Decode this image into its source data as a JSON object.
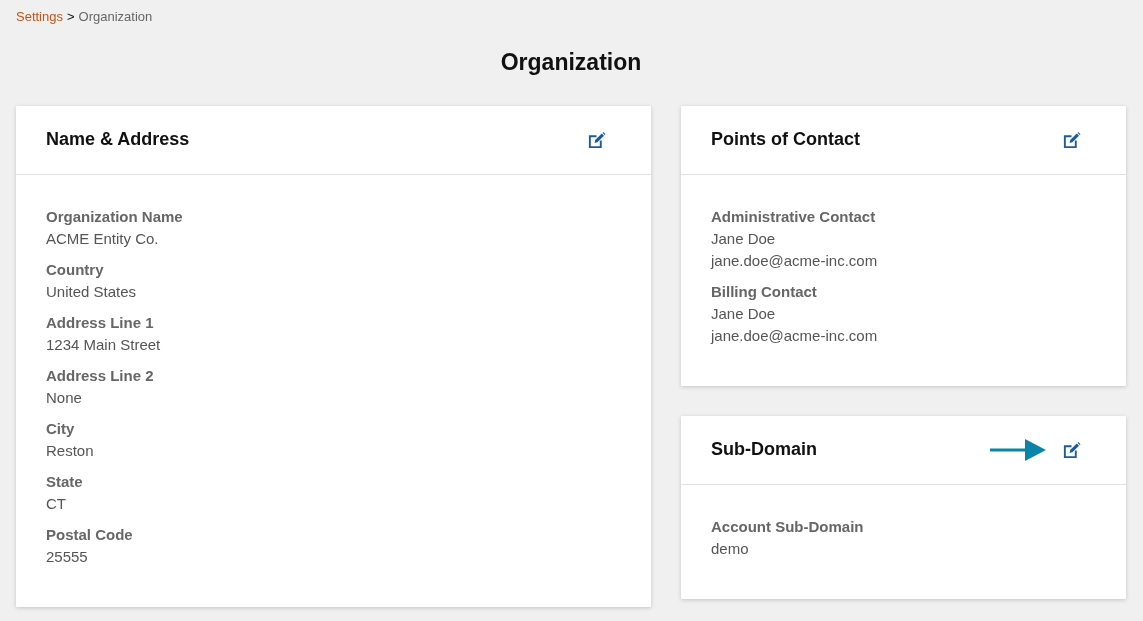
{
  "breadcrumb": [
    {
      "kind": "link",
      "label": "Settings"
    },
    {
      "kind": "separator",
      "label": ">"
    },
    {
      "kind": "current",
      "label": "Organization"
    }
  ],
  "page_title": "Organization",
  "left_column": {
    "cards": [
      {
        "title": "Name & Address",
        "pointer_arrow": false,
        "fields": [
          {
            "label": "Organization Name",
            "value": "ACME Entity Co."
          },
          {
            "label": "Country",
            "value": "United States"
          },
          {
            "label": "Address Line 1",
            "value": "1234 Main Street"
          },
          {
            "label": "Address Line 2",
            "value": "None"
          },
          {
            "label": "City",
            "value": "Reston"
          },
          {
            "label": "State",
            "value": "CT"
          },
          {
            "label": "Postal Code",
            "value": "25555"
          }
        ]
      }
    ]
  },
  "right_column": {
    "cards": [
      {
        "title": "Points of Contact",
        "pointer_arrow": false,
        "fields": [
          {
            "label": "Administrative Contact",
            "value": "Jane Doe",
            "extra": "jane.doe@acme-inc.com"
          },
          {
            "label": "Billing Contact",
            "value": "Jane Doe",
            "extra": "jane.doe@acme-inc.com"
          }
        ]
      },
      {
        "title": "Sub-Domain",
        "pointer_arrow": true,
        "fields": [
          {
            "label": "Account Sub-Domain",
            "value": "demo"
          }
        ]
      }
    ]
  }
}
